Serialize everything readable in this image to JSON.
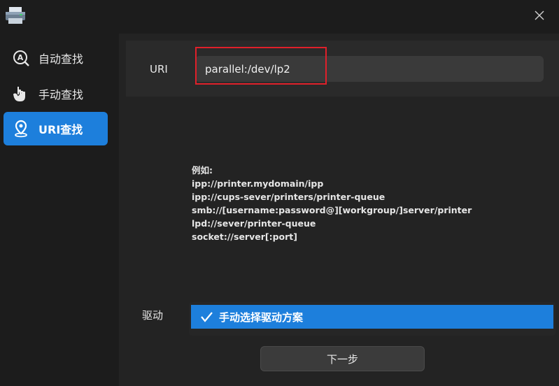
{
  "sidebar": {
    "items": [
      {
        "label": "自动查找",
        "icon": "auto-search-icon",
        "active": false
      },
      {
        "label": "手动查找",
        "icon": "hand-pointer-icon",
        "active": false
      },
      {
        "label": "URI查找",
        "icon": "location-pin-icon",
        "active": true
      }
    ]
  },
  "uri": {
    "label": "URI",
    "value": "parallel:/dev/lp2"
  },
  "examples": {
    "heading": "例如:",
    "lines": [
      "ipp://printer.mydomain/ipp",
      "ipp://cups-sever/printers/printer-queue",
      "smb://[username:password@][workgroup/]server/printer",
      "lpd://sever/printer-queue",
      "socket://server[:port]"
    ]
  },
  "driver": {
    "label": "驱动",
    "selected": "手动选择驱动方案"
  },
  "footer": {
    "next_label": "下一步"
  },
  "colors": {
    "accent": "#1d7fdc",
    "highlight": "#e0202a",
    "background": "#1c1c1c"
  }
}
